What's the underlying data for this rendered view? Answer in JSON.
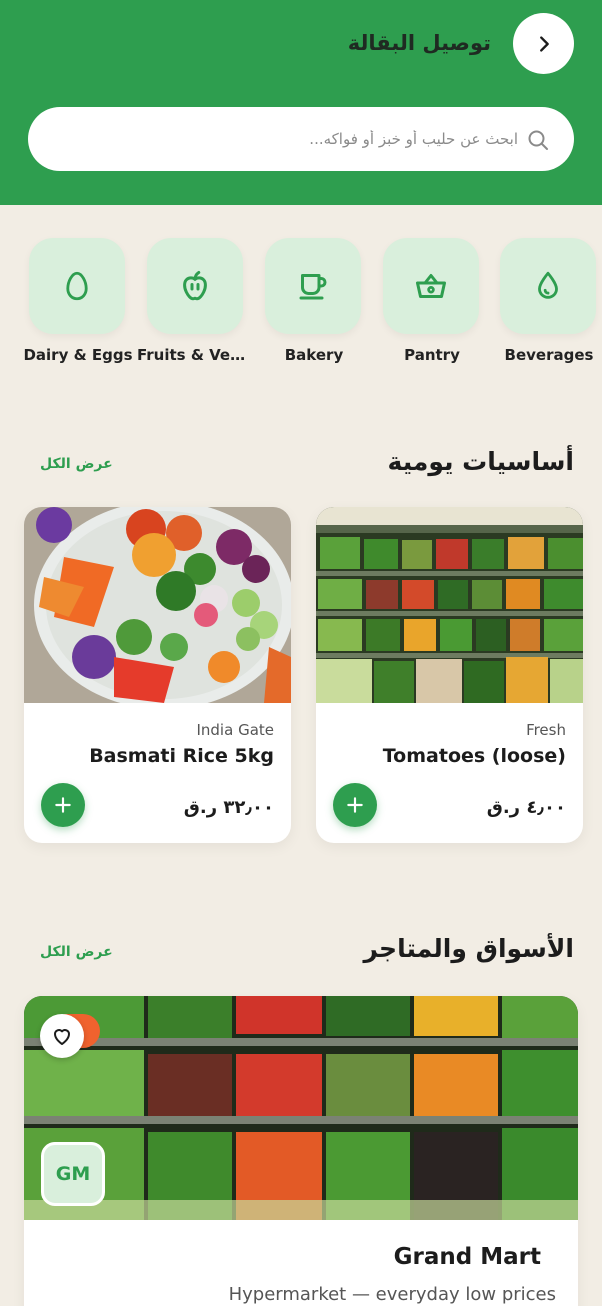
{
  "header": {
    "title": "توصيل البقالة",
    "search_placeholder": "ابحث عن حليب أو خبز أو فواكه..."
  },
  "categories": [
    {
      "label": "Dairy & Eggs",
      "icon": "egg-icon"
    },
    {
      "label": "Fruits & Vegetables",
      "icon": "apple-icon"
    },
    {
      "label": "Bakery",
      "icon": "cup-icon"
    },
    {
      "label": "Pantry",
      "icon": "basket-icon"
    },
    {
      "label": "Beverages",
      "icon": "drop-icon"
    }
  ],
  "essentials": {
    "title": "أساسيات يومية",
    "see_all": "عرض الكل",
    "products": [
      {
        "brand": "Fresh",
        "name": "Tomatoes (loose)",
        "price": "٤٫٠٠ ر.ق"
      },
      {
        "brand": "India Gate",
        "name": "Basmati Rice 5kg",
        "price": "٣٢٫٠٠ ر.ق"
      }
    ]
  },
  "stores": {
    "title": "الأسواق والمتاجر",
    "see_all": "عرض الكل",
    "items": [
      {
        "logo": "GM",
        "name": "Grand Mart",
        "subtitle": "Hypermarket — everyday low prices"
      }
    ]
  },
  "colors": {
    "brand": "#2e9e4f",
    "background": "#f2ede4",
    "tile": "#d9efdc",
    "accent": "#f0622e"
  }
}
